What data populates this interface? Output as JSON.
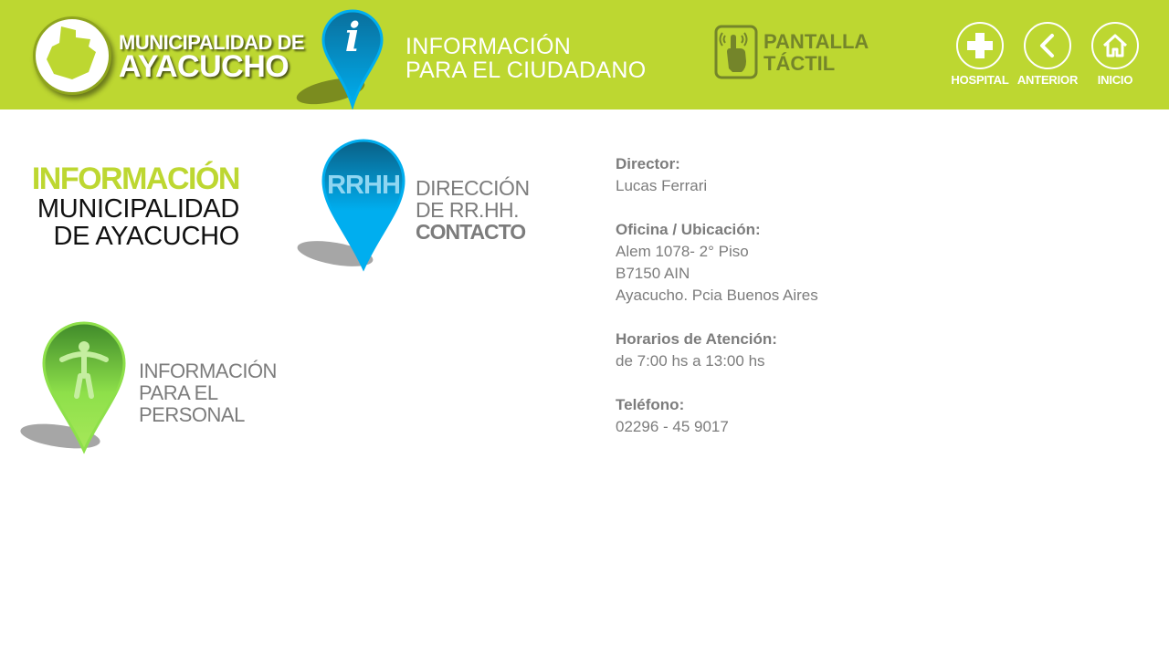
{
  "header": {
    "logo": {
      "line1": "MUNICIPALIDAD DE",
      "line2": "AYACUCHO"
    },
    "title_line1": "INFORMACIÓN",
    "title_line2": "PARA EL CIUDADANO",
    "touch_line1": "PANTALLA",
    "touch_line2": "TÁCTIL",
    "nav": {
      "hospital": "HOSPITAL",
      "back": "ANTERIOR",
      "home": "INICIO"
    }
  },
  "info": {
    "heading": "INFORMACIÓN",
    "line1": "MUNICIPALIDAD",
    "line2": "DE AYACUCHO"
  },
  "rrhh": {
    "pin_label": "RRHH",
    "line1": "DIRECCIÓN",
    "line2": "DE RR.HH.",
    "line3": "CONTACTO"
  },
  "personal": {
    "line1": "INFORMACIÓN",
    "line2": "PARA EL",
    "line3": "PERSONAL"
  },
  "contact": {
    "director_label": "Director:",
    "director_value": "Lucas Ferrari",
    "office_label": "Oficina / Ubicación:",
    "office_line1": "Alem 1078- 2° Piso",
    "office_line2": "B7150 AIN",
    "office_line3": "Ayacucho. Pcia Buenos Aires",
    "hours_label": "Horarios de Atención:",
    "hours_value": "de 7:00 hs a 13:00 hs",
    "phone_label": "Teléfono:",
    "phone_value": "02296 - 45 9017"
  },
  "colors": {
    "brand_green": "#bdd731",
    "text_gray": "#7c7c7c",
    "pin_blue": "#00aeef",
    "pin_green": "#8ee04a"
  },
  "icons": {
    "logo": "ayacucho-map-icon",
    "info_pin": "info-pin-icon",
    "touch": "touch-hand-icon",
    "hospital": "plus-icon",
    "back": "chevron-left-icon",
    "home": "home-icon",
    "rrhh_pin": "rrhh-pin-icon",
    "person_pin": "person-pin-icon"
  }
}
